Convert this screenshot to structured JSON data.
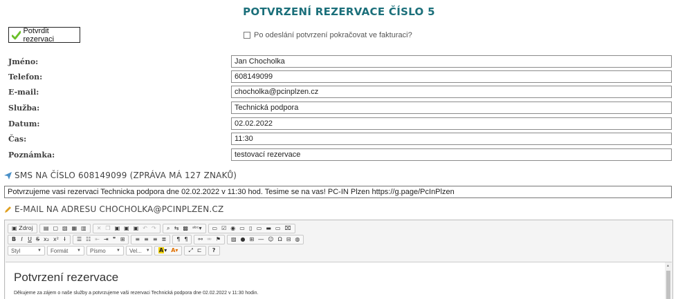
{
  "page_title": "POTVRZENÍ REZERVACE ČÍSLO 5",
  "confirm_button": "Potvrdit rezervaci",
  "continue_checkbox": {
    "label": "Po odeslání potvrzení pokračovat ve fakturaci?",
    "checked": false
  },
  "fields": {
    "name": {
      "label": "Jméno:",
      "value": "Jan Chocholka"
    },
    "phone": {
      "label": "Telefon:",
      "value": "608149099"
    },
    "email": {
      "label": "E-mail:",
      "value": "chocholka@pcinplzen.cz"
    },
    "service": {
      "label": "Služba:",
      "value": "Technická podpora"
    },
    "date": {
      "label": "Datum:",
      "value": "02.02.2022"
    },
    "time": {
      "label": "Čas:",
      "value": "11:30"
    },
    "note": {
      "label": "Poznámka:",
      "value": "testovací rezervace"
    }
  },
  "sms": {
    "heading": "SMS NA ČÍSLO 608149099 (ZPRÁVA MÁ 127 ZNAKŮ)",
    "text": "Potvrzujeme vasi rezervaci Technicka podpora dne 02.02.2022 v 11:30 hod. Tesime se na vas! PC-IN Plzen https://g.page/PcInPlzen"
  },
  "email_section": {
    "heading": "E-MAIL NA ADRESU CHOCHOLKA@PCINPLZEN.CZ",
    "toolbar": {
      "source": "Zdroj",
      "row2_bold": "B",
      "row2_italic": "I",
      "row2_underline": "U",
      "row2_strike": "S",
      "style_combo": "Styl",
      "format_combo": "Formát",
      "font_combo": "Písmo",
      "size_combo": "Vel...",
      "help": "?"
    },
    "content_heading": "Potvrzení rezervace",
    "content_text": "Děkujeme za zájem o naše služby a potvrzujeme vaši rezervaci Technická podpora dne 02.02.2022 v 11:30 hodin."
  },
  "colors": {
    "title": "#1b6f7a",
    "check": "#6bbf2a",
    "sms_icon": "#4a90c8",
    "email_icon": "#e0a020"
  }
}
